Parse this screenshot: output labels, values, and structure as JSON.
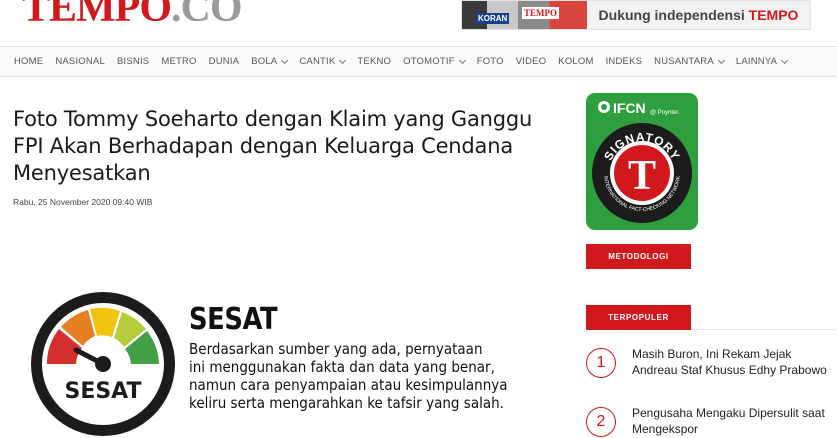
{
  "header": {
    "logo_main": "TEMPO",
    "logo_suffix": ".CO",
    "banner_tagline_pre": "Dukung independensi",
    "banner_tagline_brand": "TEMPO",
    "banner_paper1": "KORAN",
    "banner_paper2": "TEMPO"
  },
  "nav": {
    "items": [
      {
        "label": "HOME",
        "dropdown": false
      },
      {
        "label": "NASIONAL",
        "dropdown": false
      },
      {
        "label": "BISNIS",
        "dropdown": false
      },
      {
        "label": "METRO",
        "dropdown": false
      },
      {
        "label": "DUNIA",
        "dropdown": false
      },
      {
        "label": "BOLA",
        "dropdown": true
      },
      {
        "label": "CANTIK",
        "dropdown": true
      },
      {
        "label": "TEKNO",
        "dropdown": false
      },
      {
        "label": "OTOMOTIF",
        "dropdown": true
      },
      {
        "label": "FOTO",
        "dropdown": false
      },
      {
        "label": "VIDEO",
        "dropdown": false
      },
      {
        "label": "KOLOM",
        "dropdown": false
      },
      {
        "label": "INDEKS",
        "dropdown": false
      },
      {
        "label": "NUSANTARA",
        "dropdown": true
      },
      {
        "label": "LAINNYA",
        "dropdown": true
      }
    ]
  },
  "article": {
    "title": "Foto Tommy Soeharto dengan Klaim yang Ganggu FPI Akan Berhadapan dengan Keluarga Cendana Menyesatkan",
    "date": "Rabu, 25 November 2020 09:40 WIB",
    "verdict": {
      "heading": "SESAT",
      "gauge_label": "SESAT",
      "lines": [
        "Berdasarkan sumber yang ada, pernyataan",
        "ini menggunakan fakta dan data yang benar,",
        "namun cara penyampaian atau kesimpulannya",
        "keliru serta mengarahkan ke tafsir yang salah."
      ]
    }
  },
  "sidebar": {
    "badge": {
      "org": "IFCN",
      "by": "@ Poynter.",
      "arc_top": "SIGNATORY",
      "arc_bottom": "INTERNATIONAL FACT-CHECKING NETWORK",
      "letter": "T"
    },
    "metodologi_label": "METODOLOGI",
    "terpopuler_label": "TERPOPULER",
    "popular": [
      {
        "num": "1",
        "title": "Masih Buron, Ini Rekam Jejak Andreau Staf Khusus Edhy Prabowo"
      },
      {
        "num": "2",
        "title": "Pengusaha Mengaku Dipersulit saat Mengekspor"
      }
    ]
  },
  "colors": {
    "brand_red": "#d0181d",
    "ifcn_green": "#2e9e3f"
  }
}
